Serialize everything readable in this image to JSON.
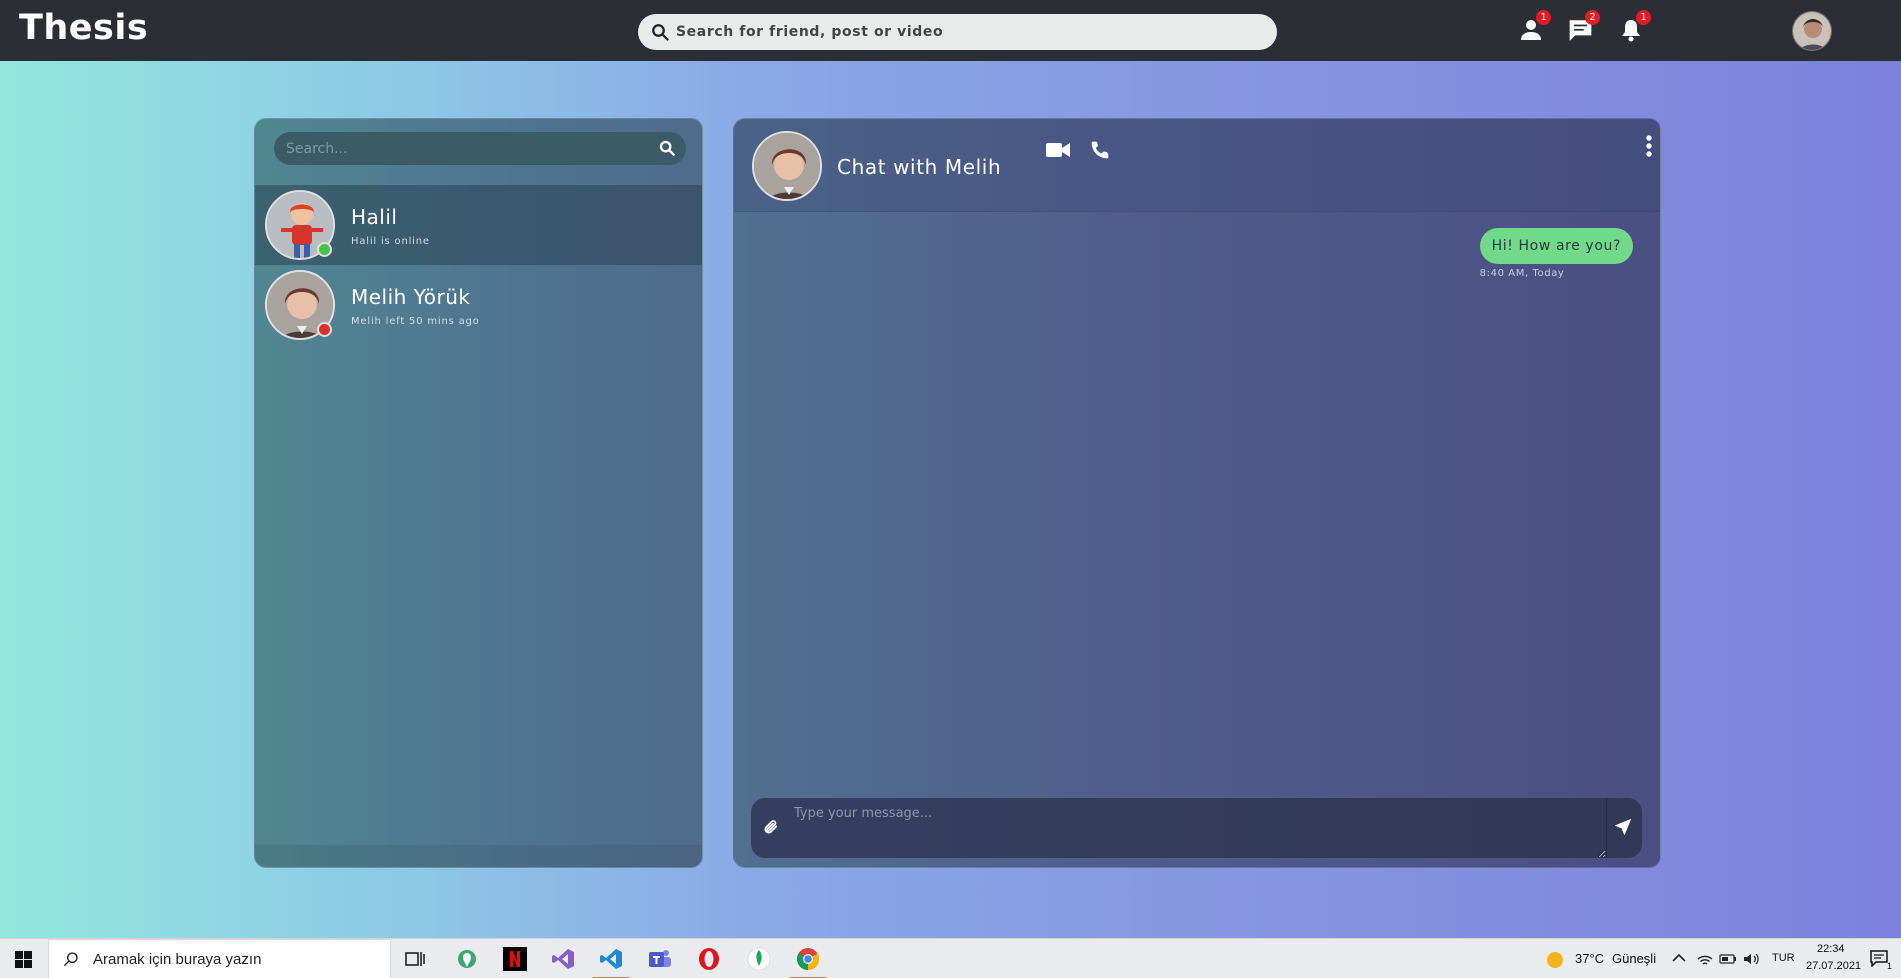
{
  "topbar": {
    "brand": "Thesis",
    "search_placeholder": "Search for friend, post or video",
    "icons": [
      {
        "name": "person-icon",
        "badge": "1"
      },
      {
        "name": "chat-icon",
        "badge": "2"
      },
      {
        "name": "bell-icon",
        "badge": "1"
      }
    ]
  },
  "contacts": {
    "search_placeholder": "Search...",
    "items": [
      {
        "name": "Halil",
        "status": "Halil is online",
        "online": true
      },
      {
        "name": "Melih Yörük",
        "status": "Melih left 50 mins ago",
        "online": false
      }
    ]
  },
  "chat": {
    "title": "Chat with Melih",
    "messages": [
      {
        "text": "Hi! How are you?",
        "time": "8:40 AM, Today"
      }
    ],
    "composer_placeholder": "Type your message..."
  },
  "taskbar": {
    "search_text": "Aramak için buraya yazın",
    "weather_temp": "37°C",
    "weather_text": "Güneşli",
    "language": "TUR",
    "time": "22:34",
    "date": "27.07.2021",
    "notification_count": "1"
  },
  "colors": {
    "online": "#47c147",
    "offline": "#d9322a",
    "bubble": "#70d98a",
    "badge": "#e51b23"
  }
}
